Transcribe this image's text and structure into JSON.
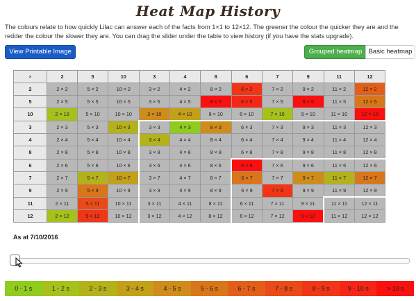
{
  "page": {
    "title": "Heat Map History",
    "description": "The colours relate to how quickly Lilac can answer each of the facts from 1×1 to 12×12. The greener the colour the quicker they are and the redder the colour the slower they are. You can drag the slider under the table to view history (if you have the stats upgrade).",
    "print_button": "View Printable Image",
    "toggle_grouped": "Grouped heatmap",
    "toggle_basic": "Basic heatmap",
    "as_at": "As at 7/10/2016"
  },
  "colors": {
    "grey": "#b8b8b8",
    "t0": "#8fcc1e",
    "t1": "#a6c11c",
    "t2": "#b4b21b",
    "t3": "#c4a01a",
    "t4": "#cf8c1a",
    "t5": "#d97619",
    "t6": "#e35f19",
    "t7": "#ea4a18",
    "t8": "#f03617",
    "t9": "#f52616",
    "t10": "#fb1010"
  },
  "heatmap": {
    "corner": "×",
    "col_headers": [
      "2",
      "5",
      "10",
      "3",
      "4",
      "8",
      "6",
      "7",
      "9",
      "11",
      "12"
    ],
    "rows": [
      {
        "h": "2",
        "cells": [
          {
            "t": "2 × 2",
            "c": "grey"
          },
          {
            "t": "5 × 2",
            "c": "grey"
          },
          {
            "t": "10 × 2",
            "c": "grey"
          },
          {
            "t": "3 × 2",
            "c": "grey"
          },
          {
            "t": "4 × 2",
            "c": "grey"
          },
          {
            "t": "8 × 2",
            "c": "grey"
          },
          {
            "t": "6 × 2",
            "c": "t8"
          },
          {
            "t": "7 × 2",
            "c": "grey"
          },
          {
            "t": "9 × 2",
            "c": "grey"
          },
          {
            "t": "11 × 2",
            "c": "grey"
          },
          {
            "t": "12 × 2",
            "c": "t6"
          }
        ]
      },
      {
        "h": "5",
        "cells": [
          {
            "t": "2 × 5",
            "c": "grey"
          },
          {
            "t": "5 × 5",
            "c": "grey"
          },
          {
            "t": "10 × 5",
            "c": "grey"
          },
          {
            "t": "3 × 5",
            "c": "grey"
          },
          {
            "t": "4 × 5",
            "c": "grey"
          },
          {
            "t": "8 × 5",
            "c": "t10"
          },
          {
            "t": "6 × 5",
            "c": "t9"
          },
          {
            "t": "7 × 5",
            "c": "grey"
          },
          {
            "t": "9 × 5",
            "c": "t10"
          },
          {
            "t": "11 × 5",
            "c": "grey"
          },
          {
            "t": "12 × 5",
            "c": "t5"
          }
        ]
      },
      {
        "h": "10",
        "cells": [
          {
            "t": "2 × 10",
            "c": "t1"
          },
          {
            "t": "5 × 10",
            "c": "grey"
          },
          {
            "t": "10 × 10",
            "c": "grey"
          },
          {
            "t": "3 × 10",
            "c": "t4"
          },
          {
            "t": "4 × 10",
            "c": "t3"
          },
          {
            "t": "8 × 10",
            "c": "grey"
          },
          {
            "t": "6 × 10",
            "c": "grey"
          },
          {
            "t": "7 × 10",
            "c": "t1"
          },
          {
            "t": "9 × 10",
            "c": "grey"
          },
          {
            "t": "11 × 10",
            "c": "grey"
          },
          {
            "t": "12 × 10",
            "c": "t10"
          }
        ]
      },
      {
        "h": "3",
        "cells": [
          {
            "t": "2 × 3",
            "c": "grey"
          },
          {
            "t": "5 × 3",
            "c": "grey"
          },
          {
            "t": "10 × 3",
            "c": "t2"
          },
          {
            "t": "3 × 3",
            "c": "grey"
          },
          {
            "t": "4 × 3",
            "c": "t0"
          },
          {
            "t": "8 × 3",
            "c": "t4"
          },
          {
            "t": "6 × 3",
            "c": "grey"
          },
          {
            "t": "7 × 3",
            "c": "grey"
          },
          {
            "t": "9 × 3",
            "c": "grey"
          },
          {
            "t": "11 × 3",
            "c": "grey"
          },
          {
            "t": "12 × 3",
            "c": "grey"
          }
        ]
      },
      {
        "h": "4",
        "cells": [
          {
            "t": "2 × 4",
            "c": "grey"
          },
          {
            "t": "5 × 4",
            "c": "grey"
          },
          {
            "t": "10 × 4",
            "c": "grey"
          },
          {
            "t": "3 × 4",
            "c": "t2"
          },
          {
            "t": "4 × 4",
            "c": "grey"
          },
          {
            "t": "8 × 4",
            "c": "grey"
          },
          {
            "t": "6 × 4",
            "c": "grey"
          },
          {
            "t": "7 × 4",
            "c": "grey"
          },
          {
            "t": "9 × 4",
            "c": "grey"
          },
          {
            "t": "11 × 4",
            "c": "grey"
          },
          {
            "t": "12 × 4",
            "c": "grey"
          }
        ]
      },
      {
        "h": "8",
        "cells": [
          {
            "t": "2 × 8",
            "c": "grey"
          },
          {
            "t": "5 × 8",
            "c": "grey"
          },
          {
            "t": "10 × 8",
            "c": "grey"
          },
          {
            "t": "3 × 8",
            "c": "grey"
          },
          {
            "t": "4 × 8",
            "c": "grey"
          },
          {
            "t": "8 × 8",
            "c": "grey"
          },
          {
            "t": "6 × 8",
            "c": "grey"
          },
          {
            "t": "7 × 8",
            "c": "grey"
          },
          {
            "t": "9 × 8",
            "c": "grey"
          },
          {
            "t": "11 × 8",
            "c": "grey"
          },
          {
            "t": "12 × 8",
            "c": "grey"
          }
        ]
      },
      {
        "h": "6",
        "cells": [
          {
            "t": "2 × 6",
            "c": "grey"
          },
          {
            "t": "5 × 6",
            "c": "grey"
          },
          {
            "t": "10 × 6",
            "c": "grey"
          },
          {
            "t": "3 × 6",
            "c": "grey"
          },
          {
            "t": "4 × 6",
            "c": "grey"
          },
          {
            "t": "8 × 6",
            "c": "grey"
          },
          {
            "t": "6 × 6",
            "c": "t10"
          },
          {
            "t": "7 × 6",
            "c": "grey"
          },
          {
            "t": "9 × 6",
            "c": "grey"
          },
          {
            "t": "11 × 6",
            "c": "grey"
          },
          {
            "t": "12 × 6",
            "c": "grey"
          }
        ]
      },
      {
        "h": "7",
        "cells": [
          {
            "t": "2 × 7",
            "c": "grey"
          },
          {
            "t": "5 × 7",
            "c": "t2"
          },
          {
            "t": "10 × 7",
            "c": "t3"
          },
          {
            "t": "3 × 7",
            "c": "grey"
          },
          {
            "t": "4 × 7",
            "c": "grey"
          },
          {
            "t": "8 × 7",
            "c": "grey"
          },
          {
            "t": "6 × 7",
            "c": "t5"
          },
          {
            "t": "7 × 7",
            "c": "grey"
          },
          {
            "t": "9 × 7",
            "c": "t4"
          },
          {
            "t": "11 × 7",
            "c": "t2"
          },
          {
            "t": "12 × 7",
            "c": "t5"
          }
        ]
      },
      {
        "h": "9",
        "cells": [
          {
            "t": "2 × 9",
            "c": "grey"
          },
          {
            "t": "5 × 9",
            "c": "t5"
          },
          {
            "t": "10 × 9",
            "c": "grey"
          },
          {
            "t": "3 × 9",
            "c": "grey"
          },
          {
            "t": "4 × 9",
            "c": "grey"
          },
          {
            "t": "8 × 9",
            "c": "grey"
          },
          {
            "t": "6 × 9",
            "c": "grey"
          },
          {
            "t": "7 × 9",
            "c": "t8"
          },
          {
            "t": "9 × 9",
            "c": "grey"
          },
          {
            "t": "11 × 9",
            "c": "grey"
          },
          {
            "t": "12 × 9",
            "c": "grey"
          }
        ]
      },
      {
        "h": "11",
        "cells": [
          {
            "t": "2 × 11",
            "c": "grey"
          },
          {
            "t": "5 × 11",
            "c": "t7"
          },
          {
            "t": "10 × 11",
            "c": "grey"
          },
          {
            "t": "3 × 11",
            "c": "grey"
          },
          {
            "t": "4 × 11",
            "c": "grey"
          },
          {
            "t": "8 × 11",
            "c": "grey"
          },
          {
            "t": "6 × 11",
            "c": "grey"
          },
          {
            "t": "7 × 11",
            "c": "grey"
          },
          {
            "t": "9 × 11",
            "c": "grey"
          },
          {
            "t": "11 × 11",
            "c": "grey"
          },
          {
            "t": "12 × 11",
            "c": "grey"
          }
        ]
      },
      {
        "h": "12",
        "cells": [
          {
            "t": "2 × 12",
            "c": "t1"
          },
          {
            "t": "5 × 12",
            "c": "t8"
          },
          {
            "t": "10 × 12",
            "c": "grey"
          },
          {
            "t": "3 × 12",
            "c": "grey"
          },
          {
            "t": "4 × 12",
            "c": "grey"
          },
          {
            "t": "8 × 12",
            "c": "grey"
          },
          {
            "t": "6 × 12",
            "c": "grey"
          },
          {
            "t": "7 × 12",
            "c": "grey"
          },
          {
            "t": "9 × 12",
            "c": "t10"
          },
          {
            "t": "11 × 12",
            "c": "grey"
          },
          {
            "t": "12 × 12",
            "c": "grey"
          }
        ]
      }
    ]
  },
  "slider": {
    "position": 0
  },
  "legend": [
    {
      "label": "0 - 1 s",
      "c": "t0"
    },
    {
      "label": "1 - 2 s",
      "c": "t1"
    },
    {
      "label": "2 - 3 s",
      "c": "t2"
    },
    {
      "label": "3 - 4 s",
      "c": "t3"
    },
    {
      "label": "4 - 5 s",
      "c": "t4"
    },
    {
      "label": "5 - 6 s",
      "c": "t5"
    },
    {
      "label": "6 - 7 s",
      "c": "t6"
    },
    {
      "label": "7 - 8 s",
      "c": "t7"
    },
    {
      "label": "8 - 9 s",
      "c": "t8"
    },
    {
      "label": "9 - 10 s",
      "c": "t9"
    },
    {
      "label": "> 10 s",
      "c": "t10"
    }
  ]
}
